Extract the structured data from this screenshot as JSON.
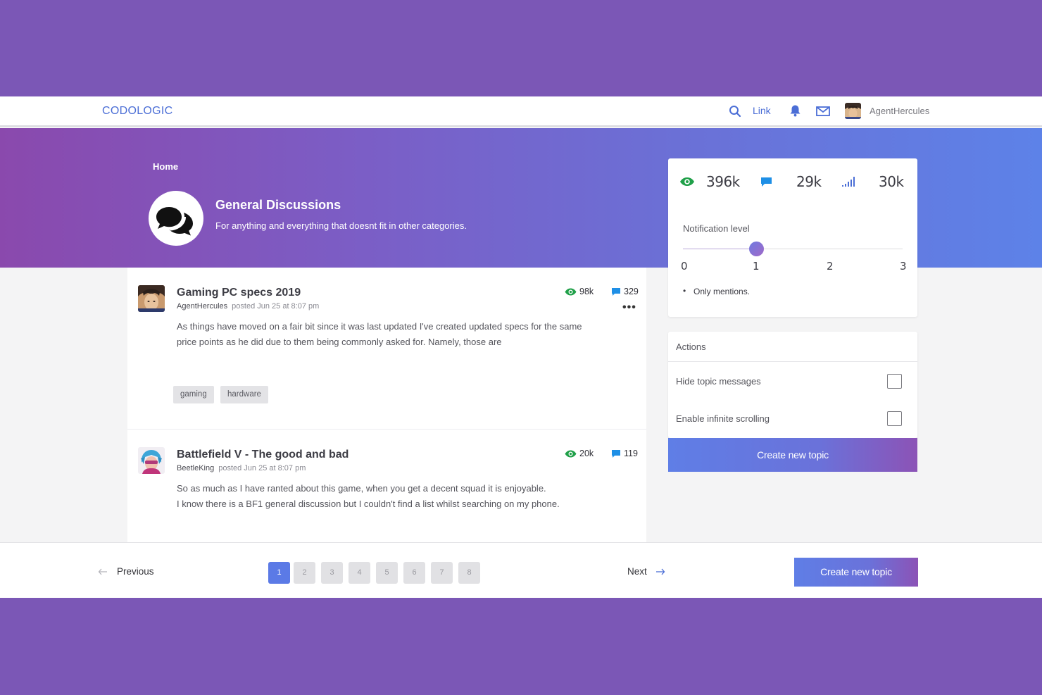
{
  "navbar": {
    "brand": "CODOLOGIC",
    "link_label": "Link",
    "username": "AgentHercules"
  },
  "hero": {
    "breadcrumb": "Home",
    "category_title": "General Discussions",
    "category_description": "For anything and everything that doesnt fit in other categories."
  },
  "topics": [
    {
      "title": "Gaming PC specs 2019",
      "author": "AgentHercules",
      "posted": "posted Jun 25 at 8:07 pm",
      "views": "98k",
      "replies": "329",
      "more_label": "•••",
      "body_lines": [
        "As things have moved on a fair bit since it was last updated I've created updated specs for the same",
        "price points as he did due to them being commonly asked for. Namely, those are"
      ],
      "tags": [
        "gaming",
        "hardware"
      ]
    },
    {
      "title": "Battlefield V - The good and bad",
      "author": "BeetleKing",
      "posted": "posted Jun 25 at 8:07 pm",
      "views": "20k",
      "replies": "119",
      "body_lines": [
        "So as much as I have ranted about this game, when you get a decent squad it is enjoyable.",
        "I know there is a BF1 general discussion but I couldn't find a list whilst searching on my phone."
      ]
    }
  ],
  "stats": {
    "views": "396k",
    "replies": "29k",
    "activity": "30k"
  },
  "notification": {
    "label": "Notification level",
    "level": 1,
    "ticks": [
      "0",
      "1",
      "2",
      "3"
    ],
    "description": "Only mentions."
  },
  "actions": {
    "title": "Actions",
    "items": [
      {
        "label": "Hide topic messages",
        "checked": false
      },
      {
        "label": "Enable infinite scrolling",
        "checked": false
      }
    ],
    "create_label": "Create new topic"
  },
  "pagination": {
    "previous_label": "Previous",
    "next_label": "Next",
    "pages": [
      "1",
      "2",
      "3",
      "4",
      "5",
      "6",
      "7",
      "8"
    ],
    "current_page": "1",
    "create_label": "Create new topic"
  },
  "colors": {
    "accent": "#4b6ed6",
    "views_icon": "#20a049",
    "replies_icon": "#1e8fe6",
    "background": "#7b57b6"
  },
  "icons": {
    "nav": [
      "search-icon",
      "bell-icon",
      "mail-icon"
    ],
    "category": "speech-bubbles-icon",
    "stats": [
      "eye-icon",
      "comment-icon",
      "signal-bars-icon"
    ]
  }
}
